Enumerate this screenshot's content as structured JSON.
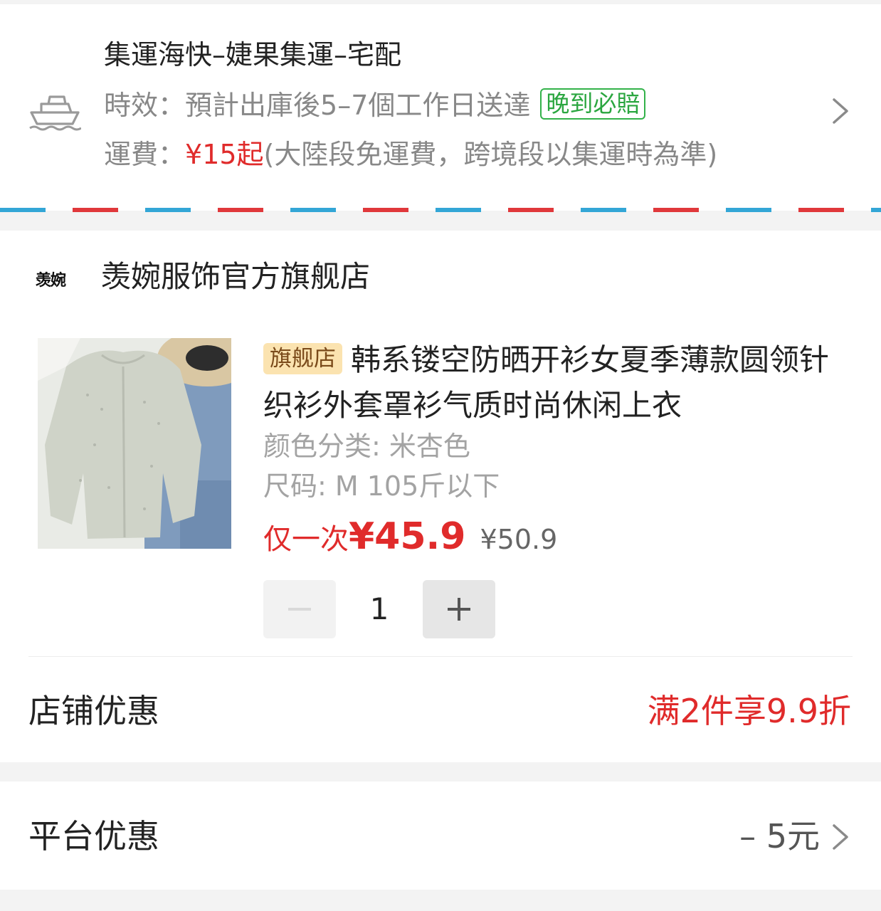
{
  "shipping": {
    "method": "集運海快–婕果集運–宅配",
    "eta_label": "時效：",
    "eta_value": "預計出庫後5–7個工作日送達",
    "guarantee_badge": "晚到必賠",
    "fee_label": "運費：",
    "fee_value": "¥15起",
    "fee_note": "(大陸段免運費，跨境段以集運時為準)",
    "icon": "ship-icon"
  },
  "store": {
    "logo_text": "羡婉",
    "name": "羡婉服饰官方旗舰店",
    "product": {
      "badge": "旗舰店",
      "title": "韩系镂空防晒开衫女夏季薄款圆领针织衫外套罩衫气质时尚休闲上衣",
      "spec_color": "颜色分类: 米杏色",
      "spec_size": "尺码: M 105斤以下",
      "price_label": "仅一次",
      "price_now": "¥45.9",
      "price_old": "¥50.9",
      "quantity": "1"
    },
    "discount_label": "店铺优惠",
    "discount_value": "满2件享9.9折"
  },
  "platform": {
    "label": "平台优惠",
    "value": "– 5元"
  },
  "colors": {
    "accent_red": "#e02b2b",
    "guarantee_green": "#2ba640",
    "badge_bg": "#fbe3b0"
  }
}
